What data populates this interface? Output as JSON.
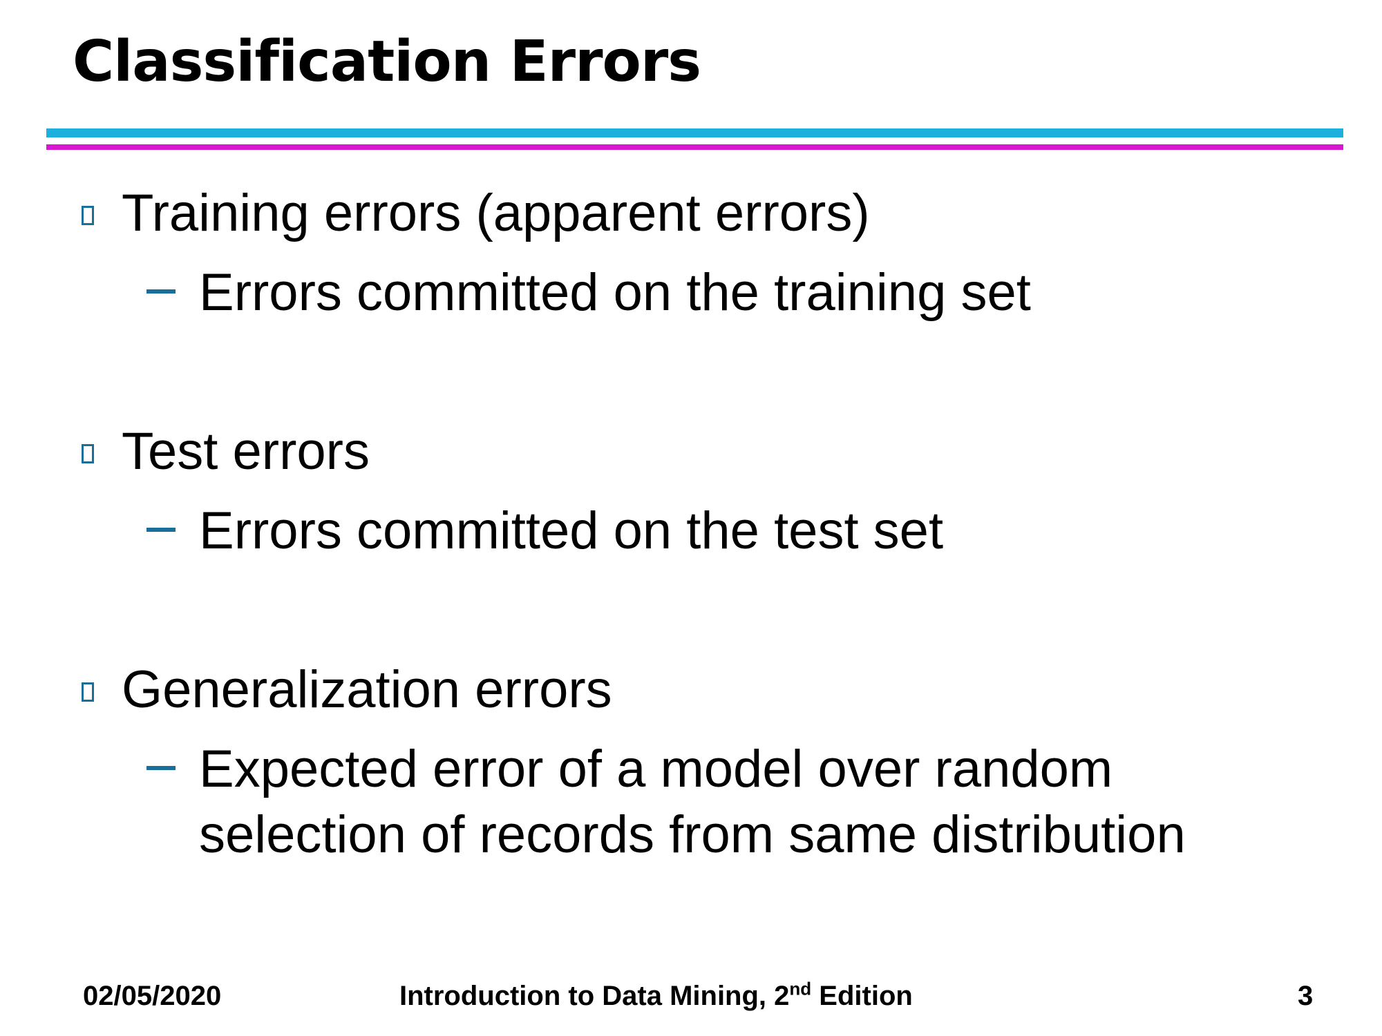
{
  "slide": {
    "title": "Classification Errors",
    "items": [
      {
        "bullet_icon": "hollow-square-icon",
        "text": "Training errors (apparent errors)",
        "sub": {
          "dash_icon": "en-dash-icon",
          "lines": [
            "Errors committed on the training set"
          ]
        }
      },
      {
        "bullet_icon": "hollow-square-icon",
        "text": "Test errors",
        "sub": {
          "dash_icon": "en-dash-icon",
          "lines": [
            "Errors committed on the test set"
          ]
        }
      },
      {
        "bullet_icon": "hollow-square-icon",
        "text": "Generalization errors",
        "sub": {
          "dash_icon": "en-dash-icon",
          "lines": [
            "Expected error of a model over random",
            "selection of records from same distribution"
          ]
        }
      }
    ]
  },
  "footer": {
    "date": "02/05/2020",
    "course_prefix": "Introduction to Data Mining, 2",
    "course_superscript": "nd",
    "course_suffix": " Edition",
    "page_number": "3"
  },
  "colors": {
    "rule_top": "#1eb0dc",
    "rule_bottom": "#d619d0",
    "bullet_accent": "#1a6e9a"
  }
}
